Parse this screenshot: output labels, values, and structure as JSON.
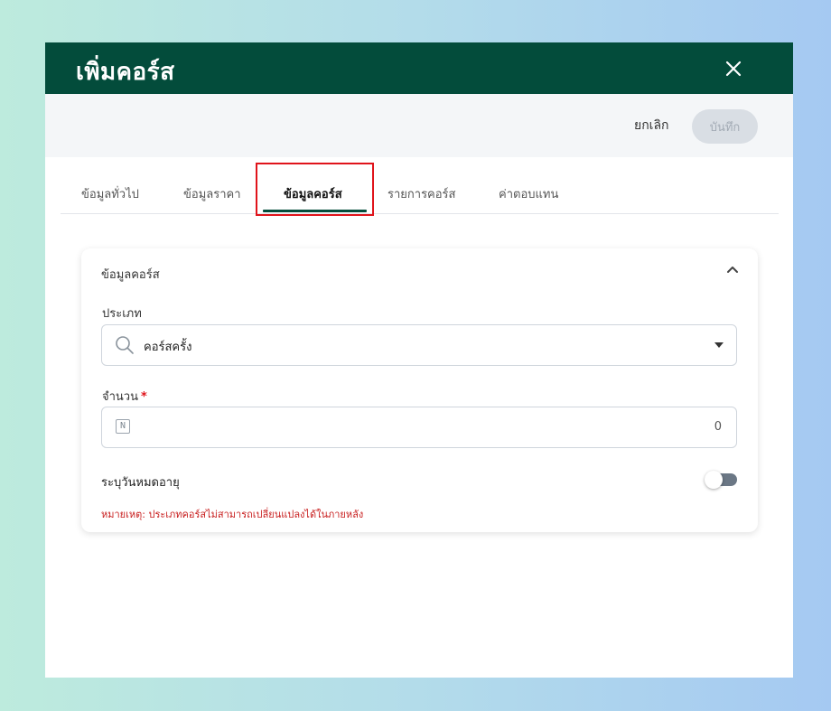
{
  "dialog": {
    "title": "เพิ่มคอร์ส",
    "close_icon": "close-icon"
  },
  "toolbar": {
    "cancel_label": "ยกเลิก",
    "save_label": "บันทึก"
  },
  "tabs": [
    {
      "label": "ข้อมูลทั่วไป",
      "active": false
    },
    {
      "label": "ข้อมูลราคา",
      "active": false
    },
    {
      "label": "ข้อมูลคอร์ส",
      "active": true
    },
    {
      "label": "รายการคอร์ส",
      "active": false
    },
    {
      "label": "ค่าตอบแทน",
      "active": false
    }
  ],
  "section": {
    "title": "ข้อมูลคอร์ส",
    "type_field": {
      "label": "ประเภท",
      "value": "คอร์สครั้ง",
      "icon": "search-icon"
    },
    "quantity_field": {
      "label": "จำนวน",
      "required_mark": "*",
      "value": "0",
      "icon_text": "N"
    },
    "expiry_toggle": {
      "label": "ระบุวันหมดอายุ",
      "on": false
    },
    "note": "หมายเหตุ: ประเภทคอร์สไม่สามารถเปลี่ยนแปลงได้ในภายหลัง"
  },
  "colors": {
    "header": "#034c3b",
    "accent_underline": "#034c3b",
    "highlight": "#e0141b",
    "note": "#c81e1e"
  }
}
